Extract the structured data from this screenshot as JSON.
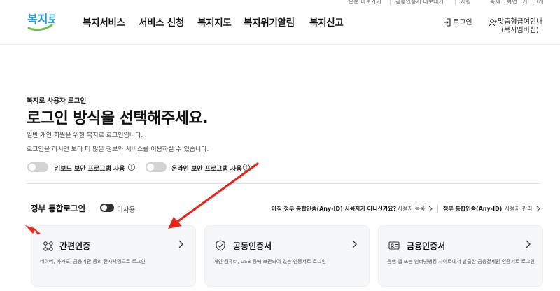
{
  "utility_bar": {
    "items": [
      "본문 바로가기",
      "공동인증서 내보내기",
      "지원",
      "축제",
      "화면크기",
      "크게"
    ]
  },
  "header": {
    "logo_text": "복지로",
    "nav": [
      "복지서비스",
      "서비스 신청",
      "복지지도",
      "복지위기알림",
      "복지신고"
    ],
    "login_label": "로그인",
    "guide_line1": "맞춤형급여안내",
    "guide_line2": "(복지멤버십)"
  },
  "section": {
    "eyebrow": "복지로 사용자 로그인",
    "title": "로그인 방식을 선택해주세요.",
    "desc1": "일반 개인 회원을 위한 복지로 로그인입니다.",
    "desc2": "로그인을 하시면 보다 더 많은 정보와 서비스를 이용하실 수 있습니다.",
    "toggle_keyboard": "키보드 보안 프로그램 사용",
    "toggle_online": "온라인 보안 프로그램 사용"
  },
  "gov_login": {
    "title": "정부 통합로그인",
    "toggle_label": "미사용",
    "question": "아직 정부 통합인증(Any-ID) 사용자가 아니신가요?",
    "register_link": "사용자 등록",
    "anyid_label": "정부 통합인증(Any-ID)",
    "manage_link": "사용자 관리"
  },
  "cards": [
    {
      "title": "간편인증",
      "desc": "네이버, 카카오, 금융기관 등의 전자서명으로 로그인",
      "icon": "network-icon"
    },
    {
      "title": "공동인증서",
      "desc": "개인 컴퓨터, USB 등에 보관되어 있는 인증서로 로그인",
      "icon": "shield-check-icon"
    },
    {
      "title": "금융인증서",
      "desc": "은행 앱 또는 인터넷뱅킹 사이트에서 발급한 금융결제원 인증서로 로그인",
      "icon": "id-card-icon"
    }
  ],
  "colors": {
    "logo_blue": "#1a9be0",
    "logo_green": "#6cc24a",
    "arrow_red": "#e8231a",
    "card_bg": "#f6f7f8"
  }
}
